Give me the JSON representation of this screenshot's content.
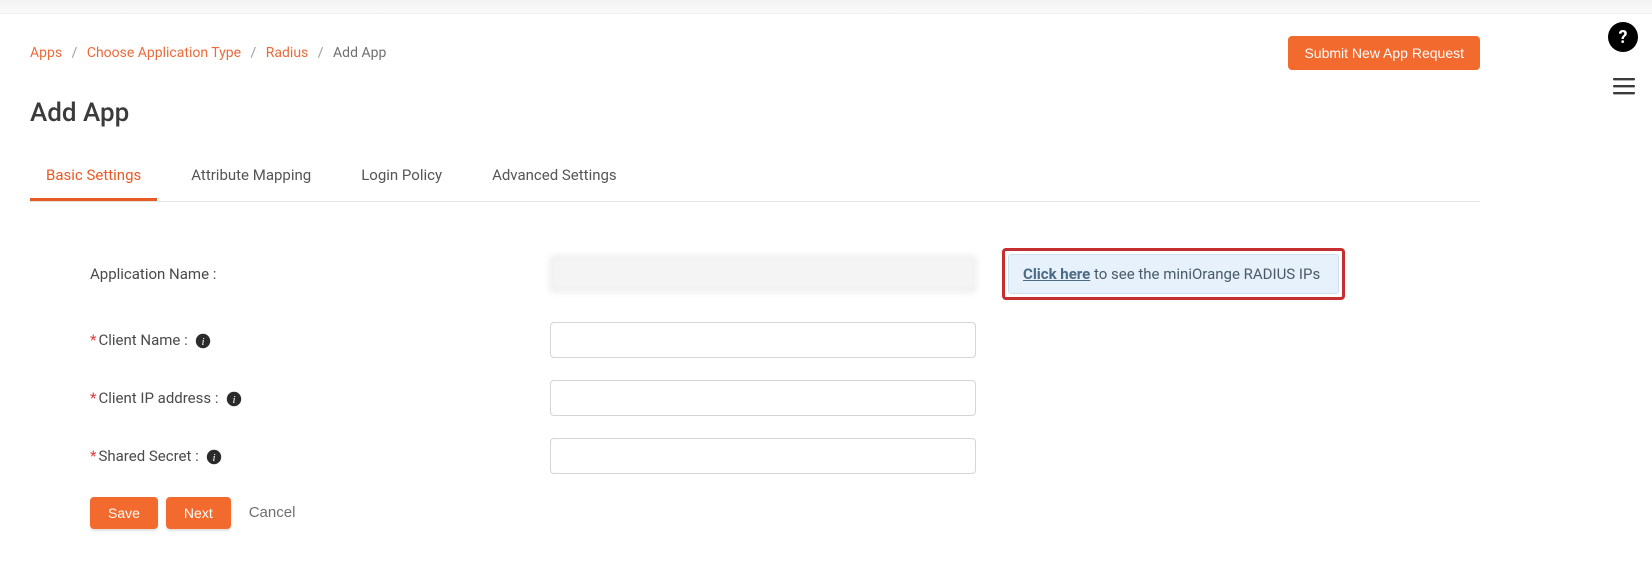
{
  "breadcrumb": {
    "apps": "Apps",
    "choose_type": "Choose Application Type",
    "radius": "Radius",
    "current": "Add App"
  },
  "header": {
    "submit_request": "Submit New App Request",
    "title": "Add App"
  },
  "tabs": {
    "basic": "Basic Settings",
    "attribute": "Attribute Mapping",
    "login": "Login Policy",
    "advanced": "Advanced Settings"
  },
  "form": {
    "application_name_label": "Application Name :",
    "application_name_value": "",
    "client_name_label": "Client Name :",
    "client_name_value": "",
    "client_ip_label": "Client IP address :",
    "client_ip_value": "",
    "shared_secret_label": "Shared Secret :",
    "shared_secret_value": ""
  },
  "info_box": {
    "link": "Click here",
    "text": " to see the miniOrange RADIUS IPs"
  },
  "actions": {
    "save": "Save",
    "next": "Next",
    "cancel": "Cancel"
  },
  "floats": {
    "help": "?"
  }
}
